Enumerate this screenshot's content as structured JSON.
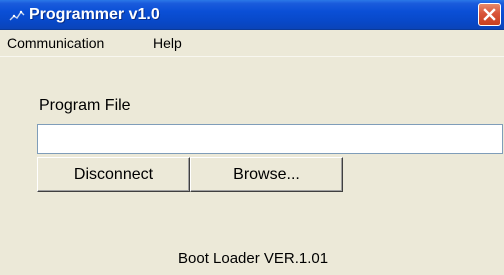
{
  "window": {
    "title": "Programmer v1.0",
    "titlebar_color": "#0a4fd6",
    "close_color": "#d9553a"
  },
  "menu": {
    "items": [
      {
        "label": "Communication"
      },
      {
        "label": "Help"
      }
    ]
  },
  "form": {
    "program_file_label": "Program File",
    "program_file_value": "",
    "disconnect_label": "Disconnect",
    "browse_label": "Browse..."
  },
  "status": {
    "text": "Boot Loader VER.1.01"
  }
}
